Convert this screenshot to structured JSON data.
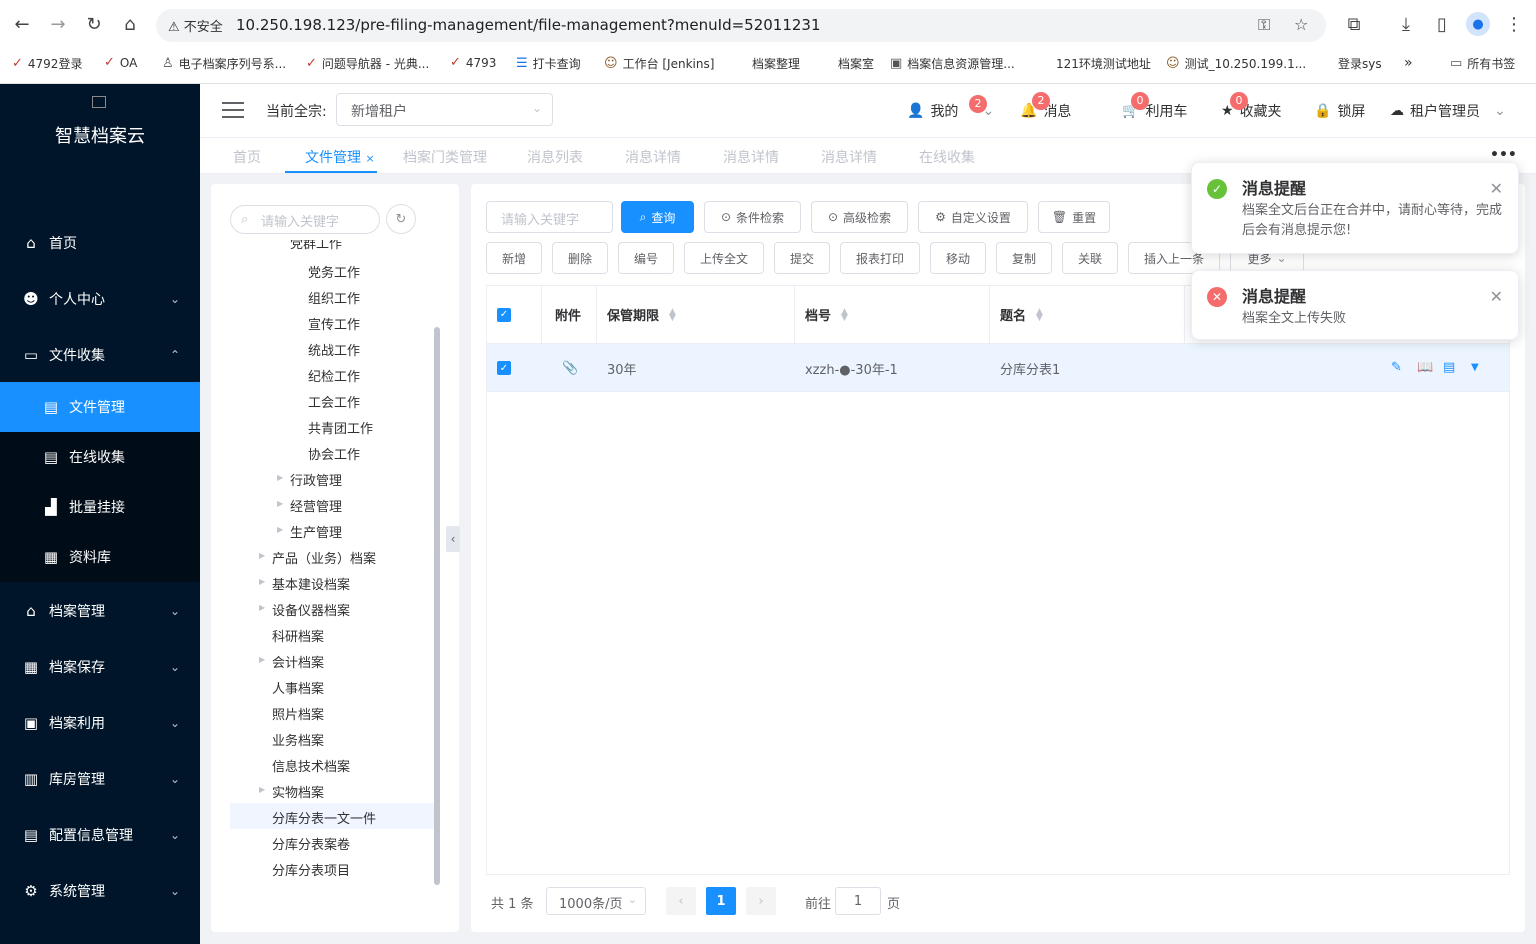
{
  "browser": {
    "security_label": "不安全",
    "url": "10.250.198.123/pre-filing-management/file-management?menuId=52011231",
    "bookmarks": [
      "4792登录",
      "OA",
      "电子档案序列号系...",
      "问题导航器 - 光典...",
      "4793",
      "打卡查询",
      "工作台 [Jenkins]",
      "档案整理",
      "档案室",
      "档案信息资源管理...",
      "121环境测试地址",
      "测试_10.250.199.1...",
      "登录sys"
    ],
    "more_bookmarks": "»",
    "all_bookmarks": "所有书签"
  },
  "app": {
    "logo_text": "智慧档案云",
    "menu": [
      {
        "label": "首页"
      },
      {
        "label": "个人中心"
      },
      {
        "label": "文件收集"
      },
      {
        "label": "文件管理"
      },
      {
        "label": "在线收集"
      },
      {
        "label": "批量挂接"
      },
      {
        "label": "资料库"
      },
      {
        "label": "档案管理"
      },
      {
        "label": "档案保存"
      },
      {
        "label": "档案利用"
      },
      {
        "label": "库房管理"
      },
      {
        "label": "配置信息管理"
      },
      {
        "label": "系统管理"
      }
    ]
  },
  "header": {
    "tenant_label": "当前全宗:",
    "tenant_value": "新增租户",
    "mine": "我的",
    "mine_badge": "2",
    "messages": "消息",
    "messages_badge": "2",
    "cart": "利用车",
    "cart_badge": "0",
    "favorites": "收藏夹",
    "favorites_badge": "0",
    "lock": "锁屏",
    "user": "租户管理员"
  },
  "tabs": [
    "首页",
    "文件管理",
    "档案门类管理",
    "消息列表",
    "消息详情",
    "消息详情",
    "消息详情",
    "在线收集"
  ],
  "tree": {
    "search_placeholder": "请输入关键字",
    "partial_top": "党群工作",
    "nodes": [
      "党务工作",
      "组织工作",
      "宣传工作",
      "统战工作",
      "纪检工作",
      "工会工作",
      "共青团工作",
      "协会工作",
      "行政管理",
      "经营管理",
      "生产管理",
      "产品（业务）档案",
      "基本建设档案",
      "设备仪器档案",
      "科研档案",
      "会计档案",
      "人事档案",
      "照片档案",
      "业务档案",
      "信息技术档案",
      "实物档案",
      "分库分表一文一件",
      "分库分表案卷",
      "分库分表项目"
    ]
  },
  "toolbar": {
    "keyword_placeholder": "请输入关键字",
    "search": "查询",
    "condition_search": "条件检索",
    "advanced_search": "高级检索",
    "custom_settings": "自定义设置",
    "reset": "重置",
    "actions": [
      "新增",
      "删除",
      "编号",
      "上传全文",
      "提交",
      "报表打印",
      "移动",
      "复制",
      "关联",
      "插入上一条",
      "更多"
    ]
  },
  "table": {
    "headers": [
      "附件",
      "保管期限",
      "档号",
      "题名"
    ],
    "rows": [
      {
        "period": "30年",
        "code": "xzzh-●-30年-1",
        "title": "分库分表1"
      }
    ]
  },
  "pagination": {
    "total": "共 1 条",
    "page_size": "1000条/页",
    "current": "1",
    "goto_label": "前往",
    "goto_value": "1",
    "page_suffix": "页"
  },
  "notifications": [
    {
      "title": "消息提醒",
      "message": "档案全文后台正在合并中，请耐心等待，完成后会有消息提示您!",
      "type": "success",
      "color": "#67c23a"
    },
    {
      "title": "消息提醒",
      "message": "档案全文上传失败",
      "type": "error",
      "color": "#f56c6c"
    }
  ]
}
